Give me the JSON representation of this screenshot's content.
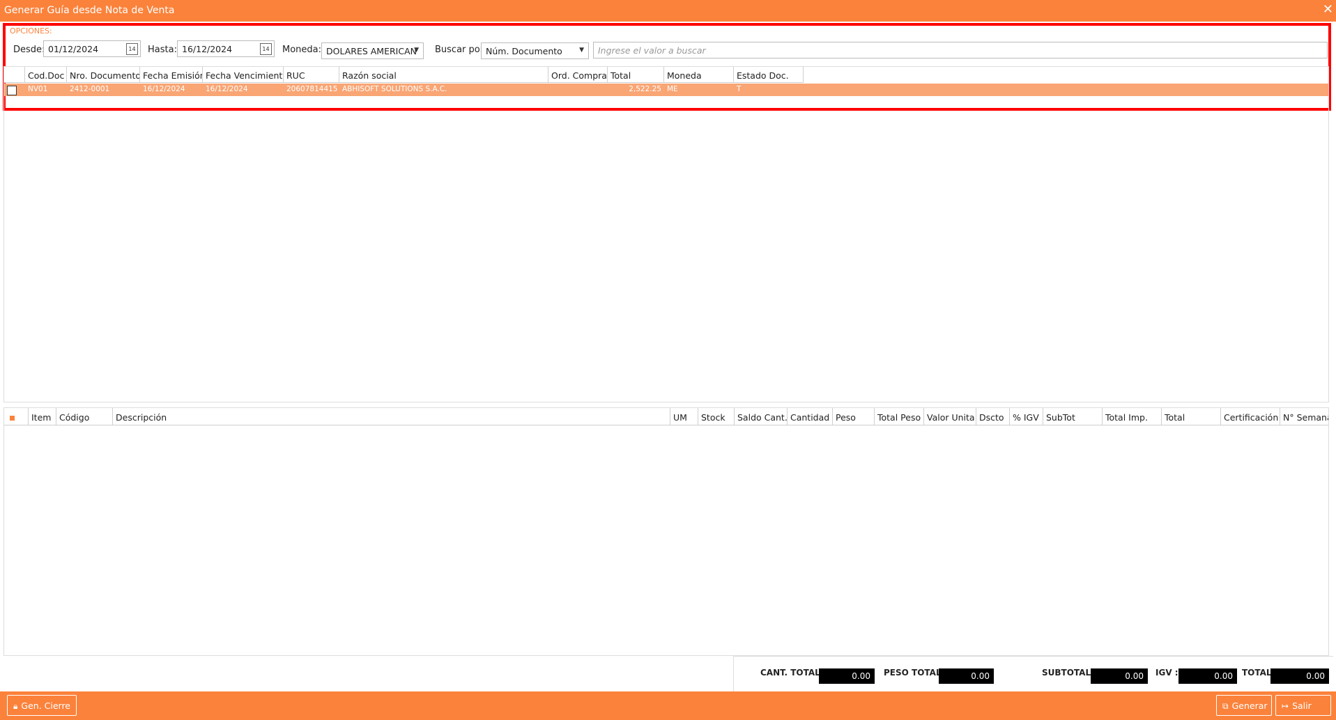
{
  "window": {
    "title": "Generar Guía desde Nota de Venta",
    "close_icon": "close-icon"
  },
  "options": {
    "section_label": "OPCIONES:",
    "desde_label": "Desde:",
    "desde_value": "01/12/2024",
    "hasta_label": "Hasta:",
    "hasta_value": "16/12/2024",
    "calendar_icon_text": "14",
    "moneda_label": "Moneda:",
    "moneda_value": "DOLARES AMERICAN",
    "buscar_label": "Buscar por:",
    "buscar_value": "Núm. Documento",
    "search_placeholder": "Ingrese el valor a buscar"
  },
  "documents_table": {
    "columns": [
      "Cod.Doc",
      "Nro. Documento",
      "Fecha Emisión",
      "Fecha Vencimiento",
      "RUC",
      "Razón social",
      "Ord. Compra",
      "Total",
      "Moneda",
      "Estado Doc."
    ],
    "rows": [
      {
        "cod_doc": "NV01",
        "nro_documento": "2412-0001",
        "fecha_emision": "16/12/2024",
        "fecha_vencimiento": "16/12/2024",
        "ruc": "20607814415",
        "razon_social": "ABHISOFT SOLUTIONS S.A.C.",
        "ord_compra": "",
        "total": "2,522.25",
        "moneda": "ME",
        "estado_doc": "T"
      }
    ]
  },
  "items_table": {
    "columns": [
      "Item",
      "Código",
      "Descripción",
      "UM",
      "Stock",
      "Saldo Cant.",
      "Cantidad",
      "Peso",
      "Total Peso",
      "Valor Unita",
      "Dscto",
      "% IGV",
      "SubTot",
      "Total Imp.",
      "Total",
      "Certificación",
      "N° Semana"
    ]
  },
  "totals": {
    "cant_total_label": "CANT. TOTAL :",
    "cant_total_value": "0.00",
    "peso_total_label": "PESO TOTAL :",
    "peso_total_value": "0.00",
    "subtotal_label": "SUBTOTAL :",
    "subtotal_value": "0.00",
    "igv_label": "IGV :",
    "igv_value": "0.00",
    "total_label": "TOTAL:",
    "total_value": "0.00"
  },
  "footer": {
    "gen_cierre_label": "Gen. Cierre",
    "generar_label": "Generar",
    "salir_label": "Salir"
  },
  "colors": {
    "accent": "#fb823b",
    "row_selected": "#f9a574",
    "highlight_border": "#ff0000"
  }
}
